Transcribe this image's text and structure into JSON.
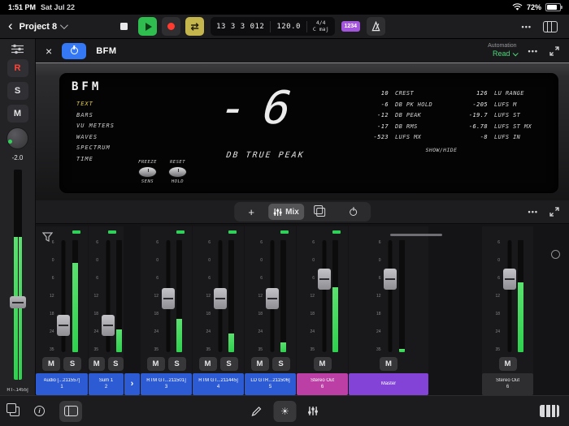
{
  "status_bar": {
    "time": "1:51 PM",
    "date": "Sat Jul 22",
    "battery": "72%"
  },
  "toolbar": {
    "project_name": "Project 8",
    "lcd": {
      "position": "13 3 3 012",
      "tempo": "120.0",
      "time_sig": "4/4",
      "key": "C maj"
    },
    "count_in": "1234"
  },
  "icons": {
    "back": "‹",
    "more": "•••",
    "cycle": "⇄",
    "close": "×",
    "info": "i"
  },
  "plugin_header": {
    "name": "BFM",
    "automation_label": "Automation",
    "automation_mode": "Read"
  },
  "plugin": {
    "logo": "BFM",
    "menu": [
      {
        "label": "TEXT",
        "active": true
      },
      {
        "label": "BARS"
      },
      {
        "label": "VU METERS"
      },
      {
        "label": "WAVES"
      },
      {
        "label": "SPECTRUM"
      },
      {
        "label": "TIME"
      }
    ],
    "display": {
      "value": "-6",
      "unit": "DB TRUE PEAK"
    },
    "knobs": [
      {
        "top_label": "FREEZE",
        "bottom_label": "SENS"
      },
      {
        "top_label": "RESET",
        "bottom_label": "HOLD"
      }
    ],
    "stats": [
      {
        "v1": "10",
        "l1": "CREST",
        "v2": "126",
        "l2": "LU RANGE"
      },
      {
        "v1": "-6",
        "l1": "DB PK HOLD",
        "v2": "-205",
        "l2": "LUFS M"
      },
      {
        "v1": "-12",
        "l1": "DB PEAK",
        "v2": "-19.7",
        "l2": "LUFS ST"
      },
      {
        "v1": "-17",
        "l1": "DB RMS",
        "v2": "-6.78",
        "l2": "LUFS ST MX"
      },
      {
        "v1": "-523",
        "l1": "LUFS MX",
        "v2": "-8",
        "l2": "LUFS IN"
      }
    ],
    "show_hide": "SHOW/HIDE"
  },
  "rail": {
    "record": "R",
    "solo": "S",
    "mute": "M",
    "knob_value": "-2.0",
    "track_name": "RT-.1455]"
  },
  "mixer_bar": {
    "add": "+",
    "mix_label": "Mix"
  },
  "mixer": {
    "scale_ticks": [
      "6",
      "0",
      "6",
      "12",
      "18",
      "24",
      "35"
    ],
    "channels": [
      {
        "name": "Audio [...211557]",
        "number": "1",
        "color": "blue",
        "size": "w64",
        "fader_pct": 75,
        "meter_pct": 80,
        "led": true,
        "mute": "M",
        "solo": "S"
      },
      {
        "name": "Sum 1",
        "number": "2",
        "color": "blue",
        "size": "w43",
        "fader_pct": 75,
        "meter_pct": 20,
        "led": true,
        "mute": "M",
        "solo": "S"
      },
      {
        "type": "disclosure",
        "glyph": "›"
      },
      {
        "name": "RTM GT...211501]",
        "number": "3",
        "color": "blue",
        "size": "w63",
        "fader_pct": 52,
        "meter_pct": 30,
        "led": true,
        "mute": "M",
        "solo": "S"
      },
      {
        "name": "RTM GT...211445]",
        "number": "4",
        "color": "blue",
        "size": "w63",
        "fader_pct": 52,
        "meter_pct": 17,
        "led": true,
        "mute": "M",
        "solo": "S"
      },
      {
        "name": "LD GTR...211506]",
        "number": "5",
        "color": "blue",
        "size": "w63",
        "fader_pct": 52,
        "meter_pct": 9,
        "led": true,
        "mute": "M",
        "solo": "S"
      },
      {
        "name": "Stereo Out",
        "number": "6",
        "color": "magenta",
        "size": "w63",
        "fader_pct": 35,
        "meter_pct": 58,
        "led": true,
        "mute": "M"
      },
      {
        "name": "Master",
        "number": "",
        "color": "purple",
        "size": "w98",
        "fader_pct": 35,
        "meter_pct": 3,
        "led": false,
        "mute": "M"
      }
    ],
    "pinned": {
      "name": "Stereo Out",
      "number": "6",
      "color": "gray",
      "size": "w63",
      "fader_pct": 35,
      "meter_pct": 62,
      "led": false,
      "mute": "M"
    }
  }
}
